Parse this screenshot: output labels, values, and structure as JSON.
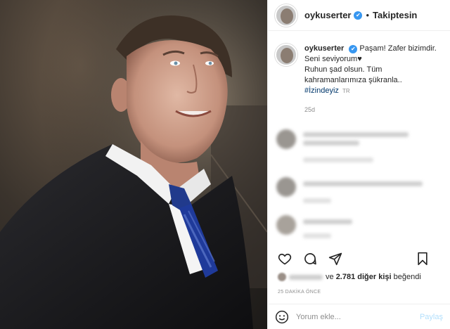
{
  "post": {
    "username": "oykuserter",
    "follow_status": "Takiptesin",
    "separator": "•",
    "verified_mark": "✔"
  },
  "caption": {
    "username": "oykuserter",
    "line1": "Paşam! Zafer bizimdir.",
    "line2": "Seni seviyorum♥",
    "line3": "Ruhun şad olsun. Tüm",
    "line4": "kahramanlarımıza şükranla..",
    "hashtag": "#İzindeyiz",
    "lang": "TR",
    "time_ago": "25d"
  },
  "engagement": {
    "likes_prefix": "ve",
    "likes_count": "2.781 diğer kişi",
    "likes_suffix": "beğendi",
    "posted_ago": "25 DAKİKA ÖNCE"
  },
  "comment_box": {
    "placeholder": "Yorum ekle...",
    "share_label": "Paylaş"
  },
  "icons": {
    "like": "heart-icon",
    "comment": "comment-icon",
    "share": "send-icon",
    "save": "bookmark-icon",
    "emoji": "emoji-icon",
    "more": "more-icon"
  },
  "colors": {
    "link": "#00376b",
    "verified": "#3897f0",
    "share_disabled": "#b2dffc",
    "muted": "#8e8e8e"
  }
}
